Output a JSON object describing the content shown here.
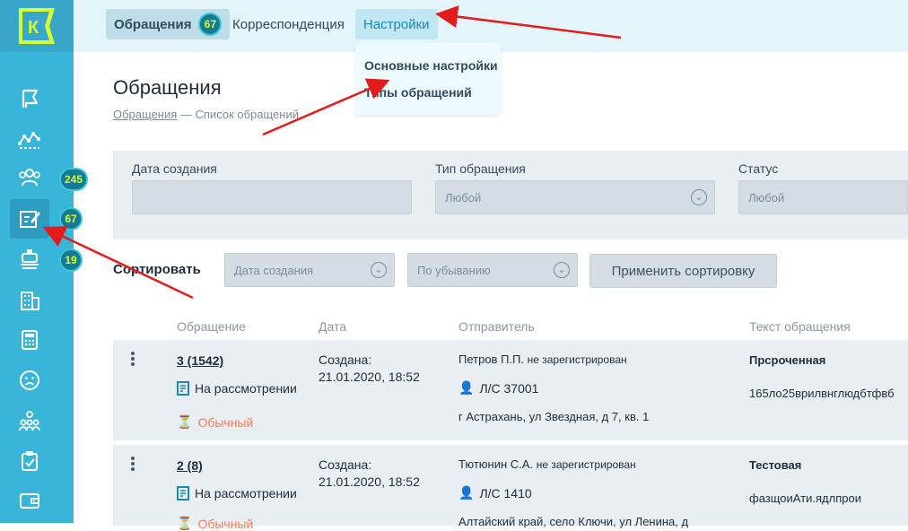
{
  "colors": {
    "sidebar": "#39b5d9",
    "topbar": "#e3f4fa",
    "badge_bg": "#167a91",
    "badge_text": "#d6ff34",
    "priority": "#ef7f5a",
    "annotation_arrow": "#e31b1b"
  },
  "logo": {
    "text": "К"
  },
  "sidebar": {
    "icons": [
      "flag-icon",
      "analytics-icon",
      "users-icon",
      "edit-icon",
      "operator-icon",
      "building-icon",
      "calculator-icon",
      "sad-face-icon",
      "people-group-icon",
      "clipboard-check-icon",
      "wallet-icon"
    ],
    "badges": {
      "users": "245",
      "appeals": "67",
      "operator": "19"
    }
  },
  "topbar": {
    "tabs": [
      {
        "label": "Обращения",
        "badge": "67"
      },
      {
        "label": "Корреспонденция"
      },
      {
        "label": "Настройки"
      }
    ],
    "dropdown": [
      "Основные настройки",
      "Типы обращений"
    ]
  },
  "page": {
    "title": "Обращения",
    "breadcrumb_link": "Обращения",
    "breadcrumb_rest": " — Список обращений"
  },
  "filters": {
    "date_label": "Дата создания",
    "type_label": "Тип обращения",
    "type_value": "Любой",
    "status_label": "Статус",
    "status_value": "Любой"
  },
  "sort": {
    "label": "Сортировать",
    "field": "Дата создания",
    "order": "По убыванию",
    "apply": "Применить сортировку"
  },
  "table": {
    "headers": [
      "Обращение",
      "Дата",
      "Отправитель",
      "Текст обращения"
    ],
    "rows": [
      {
        "number": "3 (1542)",
        "status": "На рассмотрении",
        "priority": "Обычный",
        "date_label": "Создана:",
        "date": "21.01.2020, 18:52",
        "sender": "Петров П.П.",
        "sender_note": "не зарегистрирован",
        "account": "Л/С 37001",
        "address": "г Астрахань, ул Звездная, д 7, кв. 1",
        "text_title": "Прсроченная",
        "text_body": "165ло25врилвнглюдбтфвб"
      },
      {
        "number": "2 (8)",
        "status": "На рассмотрении",
        "priority": "Обычный",
        "date_label": "Создана:",
        "date": "21.01.2020, 18:52",
        "sender": "Тютюнин С.А.",
        "sender_note": "не зарегистрирован",
        "account": "Л/С 1410",
        "address": "Алтайский край, село Ключи, ул Ленина, д",
        "text_title": "Тестовая",
        "text_body": "фазщоиАти.ядлпрои"
      }
    ]
  }
}
